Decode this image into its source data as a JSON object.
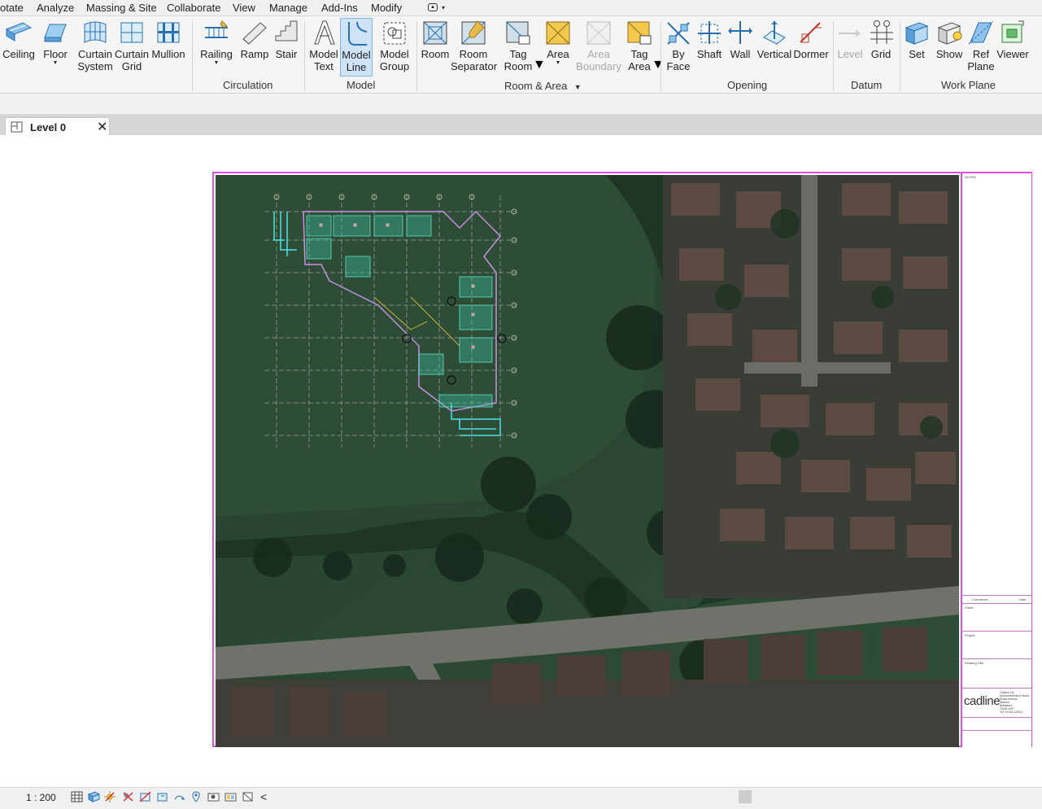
{
  "menu": {
    "tabs": [
      "otate",
      "Analyze",
      "Massing & Site",
      "Collaborate",
      "View",
      "Manage",
      "Add-Ins",
      "Modify"
    ]
  },
  "ribbon": {
    "tools": [
      {
        "id": "ceiling",
        "label": "Ceiling",
        "label2": "",
        "icon": "ceiling-icon"
      },
      {
        "id": "floor",
        "label": "Floor",
        "label2": "",
        "icon": "floor-icon"
      },
      {
        "id": "curtain-system",
        "label": "Curtain",
        "label2": "System",
        "icon": "curtain-system-icon"
      },
      {
        "id": "curtain-grid",
        "label": "Curtain",
        "label2": "Grid",
        "icon": "curtain-grid-icon"
      },
      {
        "id": "mullion",
        "label": "Mullion",
        "label2": "",
        "icon": "mullion-icon"
      },
      {
        "id": "railing",
        "label": "Railing",
        "label2": "",
        "icon": "railing-icon"
      },
      {
        "id": "ramp",
        "label": "Ramp",
        "label2": "",
        "icon": "ramp-icon"
      },
      {
        "id": "stair",
        "label": "Stair",
        "label2": "",
        "icon": "stair-icon"
      },
      {
        "id": "model-text",
        "label": "Model",
        "label2": "Text",
        "icon": "model-text-icon"
      },
      {
        "id": "model-line",
        "label": "Model",
        "label2": "Line",
        "icon": "model-line-icon"
      },
      {
        "id": "model-group",
        "label": "Model",
        "label2": "Group",
        "icon": "model-group-icon"
      },
      {
        "id": "room",
        "label": "Room",
        "label2": "",
        "icon": "room-icon"
      },
      {
        "id": "room-separator",
        "label": "Room",
        "label2": "Separator",
        "icon": "room-separator-icon"
      },
      {
        "id": "tag-room",
        "label": "Tag",
        "label2": "Room",
        "icon": "tag-room-icon"
      },
      {
        "id": "area",
        "label": "Area",
        "label2": "",
        "icon": "area-icon"
      },
      {
        "id": "area-boundary",
        "label": "Area",
        "label2": "Boundary",
        "icon": "area-boundary-icon"
      },
      {
        "id": "tag-area",
        "label": "Tag",
        "label2": "Area",
        "icon": "tag-area-icon"
      },
      {
        "id": "by-face",
        "label": "By",
        "label2": "Face",
        "icon": "by-face-icon"
      },
      {
        "id": "shaft",
        "label": "Shaft",
        "label2": "",
        "icon": "shaft-icon"
      },
      {
        "id": "wall",
        "label": "Wall",
        "label2": "",
        "icon": "wall-opening-icon"
      },
      {
        "id": "vertical",
        "label": "Vertical",
        "label2": "",
        "icon": "vertical-opening-icon"
      },
      {
        "id": "dormer",
        "label": "Dormer",
        "label2": "",
        "icon": "dormer-icon"
      },
      {
        "id": "level",
        "label": "Level",
        "label2": "",
        "icon": "level-icon"
      },
      {
        "id": "grid",
        "label": "Grid",
        "label2": "",
        "icon": "grid-icon"
      },
      {
        "id": "set",
        "label": "Set",
        "label2": "",
        "icon": "set-icon"
      },
      {
        "id": "show",
        "label": "Show",
        "label2": "",
        "icon": "show-icon"
      },
      {
        "id": "ref-plane",
        "label": "Ref",
        "label2": "Plane",
        "icon": "ref-plane-icon"
      },
      {
        "id": "viewer",
        "label": "Viewer",
        "label2": "",
        "icon": "viewer-icon"
      }
    ],
    "panels": {
      "circulation": "Circulation",
      "model": "Model",
      "room_area": "Room & Area",
      "opening": "Opening",
      "datum": "Datum",
      "work_plane": "Work Plane"
    },
    "active_tool": "model-line",
    "disabled_tools": [
      "area-boundary",
      "level"
    ]
  },
  "view_tab": {
    "title": "Level 0",
    "close": "✕"
  },
  "titleblock": {
    "notes": "NOTES",
    "comments": "Comments",
    "date": "Date",
    "client": "Client",
    "project": "Project",
    "drawing_title": "Drawing Title",
    "logo": "cadline",
    "address": "Cadline Ltd\nNorthumberland House\nDrake Avenue\nStaines\nMiddlesex\nTW18 2AP\nTel: 01784 419911"
  },
  "statusbar": {
    "scale": "1 : 200",
    "collapse_arrow": "<"
  },
  "colors": {
    "accent_active": "#cfe3f6",
    "sheet_border": "#e14ee0",
    "plan_lines": "#c7a6e0",
    "plan_cyan": "#4fe0e8",
    "grass": "#2c4a36"
  }
}
